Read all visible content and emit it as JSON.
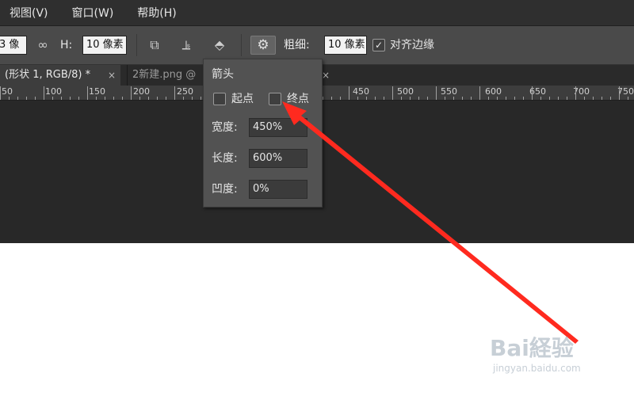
{
  "menubar": {
    "items": [
      "视图(V)",
      "窗口(W)",
      "帮助(H)"
    ]
  },
  "toolbar": {
    "w_value": "3 像",
    "link_icon": "link-icon",
    "h_label": "H:",
    "h_value": "10 像素",
    "path_ops_icon": "path-operations-icon",
    "align_icon": "path-alignment-icon",
    "arrange_icon": "path-arrangement-icon",
    "gear_icon": "gear-icon",
    "weight_label": "粗细:",
    "weight_value": "10 像素",
    "align_edges_checked": true,
    "align_edges_label": "对齐边缘"
  },
  "tabs": [
    {
      "label": "(形状 1, RGB/8) *",
      "close": "×",
      "active": true
    },
    {
      "label": "2新建.png @",
      "close": "×",
      "active": false
    },
    {
      "label": "",
      "close": "×",
      "active": false
    }
  ],
  "ruler": {
    "labels": [
      "50",
      "100",
      "150",
      "200",
      "250",
      "450",
      "500",
      "550",
      "600",
      "650",
      "700",
      "750"
    ]
  },
  "arrow_popup": {
    "title": "箭头",
    "start_label": "起点",
    "start_checked": false,
    "end_label": "终点",
    "end_checked": false,
    "width_label": "宽度:",
    "width_value": "450%",
    "length_label": "长度:",
    "length_value": "600%",
    "concavity_label": "凹度:",
    "concavity_value": "0%"
  },
  "annotation": {
    "color": "#ff2a1f"
  },
  "watermark": {
    "text": "Bai経验",
    "url": "jingyan.baidu.com"
  }
}
